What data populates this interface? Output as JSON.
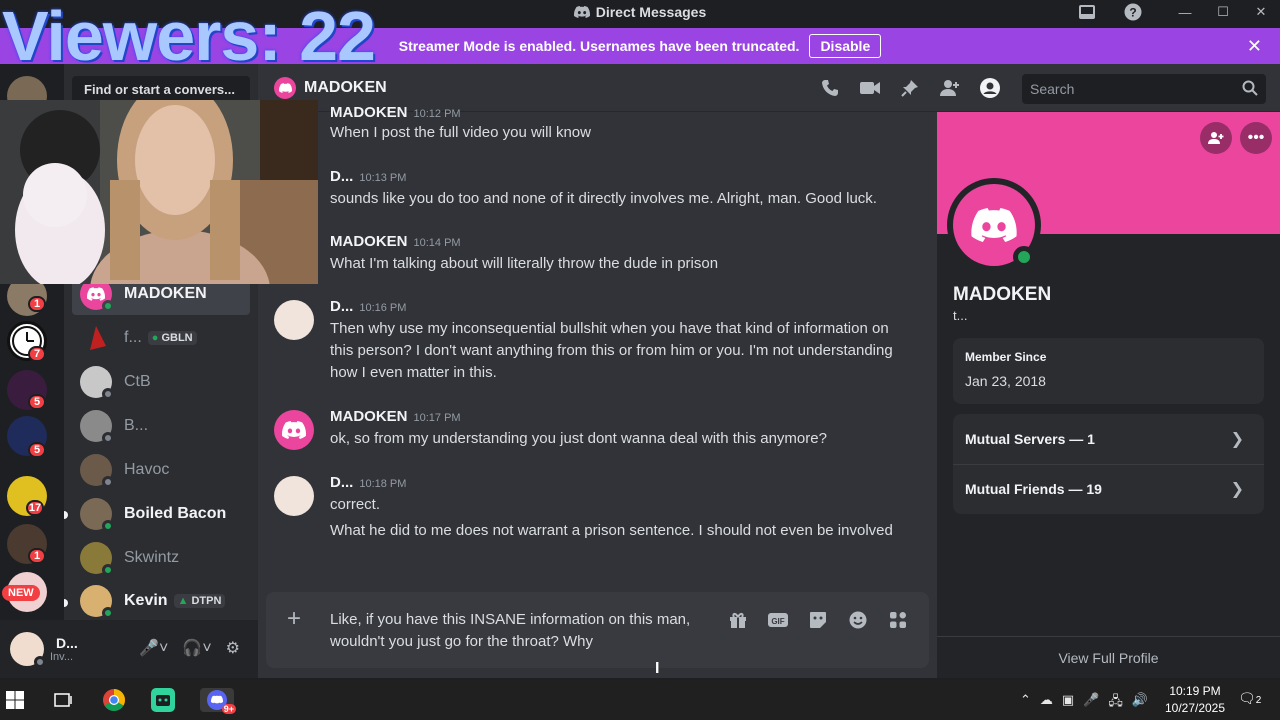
{
  "overlay": {
    "viewers": "Viewers: 22"
  },
  "window": {
    "title": "Direct Messages"
  },
  "banner": {
    "text": "Streamer Mode is enabled. Usernames have been truncated.",
    "button": "Disable"
  },
  "sidebar": {
    "search_placeholder": "Find or start a convers...",
    "dms": [
      {
        "name": "MADOKEN",
        "active": true
      },
      {
        "name": "f...",
        "tag": "GBLN"
      },
      {
        "name": "CtB"
      },
      {
        "name": "B..."
      },
      {
        "name": "Havoc"
      },
      {
        "name": "Boiled Bacon"
      },
      {
        "name": "Skwintz"
      },
      {
        "name": "Kevin",
        "tag": "DTPN"
      }
    ],
    "server_badges": [
      "1",
      "7",
      "5",
      "5",
      "17",
      "1"
    ],
    "new_pill": "NEW"
  },
  "user": {
    "name": "D...",
    "status": "Inv..."
  },
  "chat": {
    "recipient": "MADOKEN",
    "search_placeholder": "Search",
    "messages": [
      {
        "author": "MADOKEN",
        "time": "10:12 PM",
        "text": "When I post the full video you will know"
      },
      {
        "author": "D...",
        "time": "10:13 PM",
        "text": "sounds like you do too and none of it directly involves me.  Alright, man.  Good luck."
      },
      {
        "author": "MADOKEN",
        "time": "10:14 PM",
        "text": "What I'm talking about will literally throw the dude in prison"
      },
      {
        "author": "D...",
        "time": "10:16 PM",
        "text": "Then why use my inconsequential bullshit when you have that kind of information on this person?  I don't want anything from this or from him or you.  I'm not understanding how I even matter in this."
      },
      {
        "author": "MADOKEN",
        "time": "10:17 PM",
        "text": "ok, so from my understanding you just dont wanna deal with this anymore?"
      },
      {
        "author": "D...",
        "time": "10:18 PM",
        "text": "correct.",
        "text2": "What he did to me does not warrant a prison sentence.  I should not even be involved"
      }
    ],
    "draft": "Like, if you have this INSANE information on this man, wouldn't you just go for the throat?  Why"
  },
  "profile": {
    "name": "MADOKEN",
    "subtitle": "t...",
    "member_since_label": "Member Since",
    "member_since": "Jan 23, 2018",
    "mutual_servers": "Mutual Servers — 1",
    "mutual_friends": "Mutual Friends — 19",
    "view_full": "View Full Profile",
    "accent_color": "#eb459e"
  },
  "taskbar": {
    "time": "10:19 PM",
    "date": "10/27/2025",
    "notifications": "2",
    "discord_badge": "9+"
  }
}
